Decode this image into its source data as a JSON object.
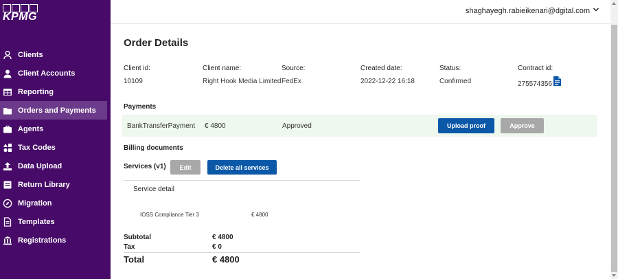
{
  "brand": {
    "logo_text": "KPMG"
  },
  "sidebar": {
    "items": [
      {
        "label": "Clients",
        "icon": "user-icon",
        "active": false
      },
      {
        "label": "Client Accounts",
        "icon": "user-icon",
        "active": false
      },
      {
        "label": "Reporting",
        "icon": "table-icon",
        "active": false
      },
      {
        "label": "Orders and Payments",
        "icon": "folder-icon",
        "active": true
      },
      {
        "label": "Agents",
        "icon": "briefcase-icon",
        "active": false
      },
      {
        "label": "Tax Codes",
        "icon": "shapes-icon",
        "active": false
      },
      {
        "label": "Data Upload",
        "icon": "upload-icon",
        "active": false
      },
      {
        "label": "Return Library",
        "icon": "book-icon",
        "active": false
      },
      {
        "label": "Migration",
        "icon": "compass-icon",
        "active": false
      },
      {
        "label": "Templates",
        "icon": "document-icon",
        "active": false
      },
      {
        "label": "Registrations",
        "icon": "bank-icon",
        "active": false
      }
    ]
  },
  "header": {
    "user_email": "shaghayegh.rabieikenari@dgital.com"
  },
  "page": {
    "title": "Order Details"
  },
  "order": {
    "client_id_label": "Client id:",
    "client_id": "10109",
    "client_name_label": "Client name:",
    "client_name": "Right Hook Media Limited",
    "source_label": "Source:",
    "source": "FedEx",
    "created_label": "Created date:",
    "created": "2022-12-22 16:18",
    "status_label": "Status:",
    "status": "Confirmed",
    "contract_label": "Contract id:",
    "contract": "275574356"
  },
  "payments": {
    "title": "Payments",
    "method": "BankTransferPayment",
    "amount": "€ 4800",
    "status": "Approved",
    "upload_label": "Upload proof",
    "approve_label": "Approve"
  },
  "billing": {
    "title": "Billing documents"
  },
  "services": {
    "title": "Services (v1)",
    "edit_label": "Edit",
    "delete_label": "Delete all services",
    "detail_label": "Service detail",
    "items": [
      {
        "name": "IOSS Compliance Tier 3",
        "price": "€ 4800"
      }
    ]
  },
  "totals": {
    "subtotal_label": "Subtotal",
    "subtotal": "€ 4800",
    "tax_label": "Tax",
    "tax": "€ 0",
    "total_label": "Total",
    "total": "€ 4800"
  },
  "colors": {
    "sidebar_bg": "#470a68",
    "primary_button": "#0b58a8",
    "disabled_button": "#a8a8a8",
    "payment_row_bg": "#eef8ee"
  }
}
